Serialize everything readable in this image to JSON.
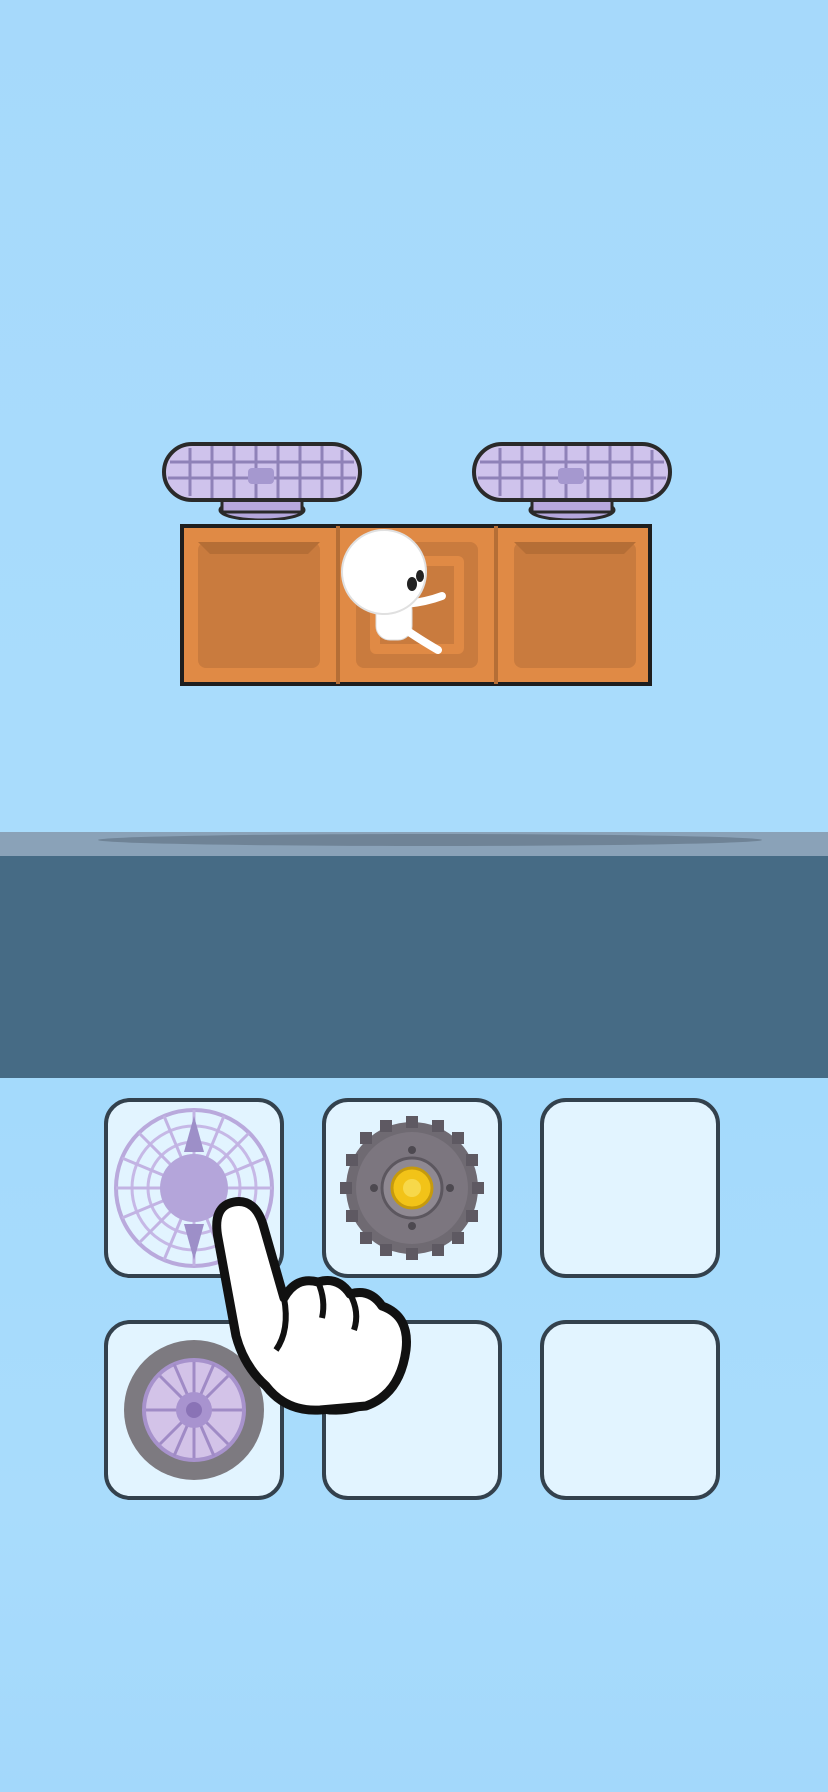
{
  "game": {
    "vehicle": {
      "top_parts": [
        "fan-part",
        "fan-part"
      ],
      "body_blocks": 3,
      "pilot": "white-stick-figure"
    },
    "inventory": {
      "rows": 2,
      "columns": 3,
      "slots": [
        {
          "item": "fan-part"
        },
        {
          "item": "spiked-wheel-part"
        },
        {
          "item": ""
        },
        {
          "item": "wheel-part"
        },
        {
          "item": ""
        },
        {
          "item": ""
        }
      ]
    },
    "tutorial_hint": "pointing-hand-icon"
  },
  "colors": {
    "sky": "#a9dcfc",
    "crate": "#e08a45",
    "crate_inner": "#c97b3e",
    "fan": "#c9bde6",
    "platform": "#466b85",
    "platform_top": "#8aa2b8",
    "slot_fill": "#e2f4ff",
    "slot_border": "#33414d",
    "wheel_hub": "#f2c318"
  }
}
